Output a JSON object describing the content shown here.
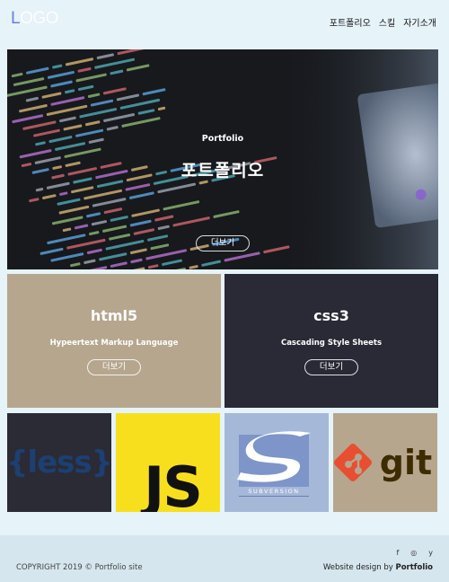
{
  "header": {
    "logo_first": "L",
    "logo_rest": "OGO",
    "nav": [
      "포트폴리오",
      "스킬",
      "자기소개"
    ]
  },
  "hero": {
    "subtitle": "Portfolio",
    "title": "포트폴리오",
    "button": "더보기"
  },
  "panels": [
    {
      "title": "html5",
      "subtitle": "Hypeertext Markup Language",
      "button": "더보기",
      "color": "#b6a68e"
    },
    {
      "title": "css3",
      "subtitle": "Cascading Style Sheets",
      "button": "더보기",
      "color": "#292a35"
    }
  ],
  "tiles": [
    {
      "label": "{less}",
      "color": "#2a2b35"
    },
    {
      "label": "JS",
      "color": "#f7df1e"
    },
    {
      "label": "SUBVERSION",
      "color": "#a6b8d8"
    },
    {
      "label": "git",
      "color": "#b6a68e"
    }
  ],
  "footer": {
    "social": [
      "f",
      "◎",
      "y"
    ],
    "social_icons": [
      "facebook-icon",
      "pinterest-icon",
      "twitter-icon"
    ],
    "copyright": "COPYRIGHT 2019 © Portfolio site",
    "credit_prefix": "Website design by ",
    "credit_name": "Portfolio"
  },
  "colors": {
    "background": "#e6f3f9",
    "logo_accent": "#6c7fe0",
    "footer": "#d6e6ee"
  }
}
